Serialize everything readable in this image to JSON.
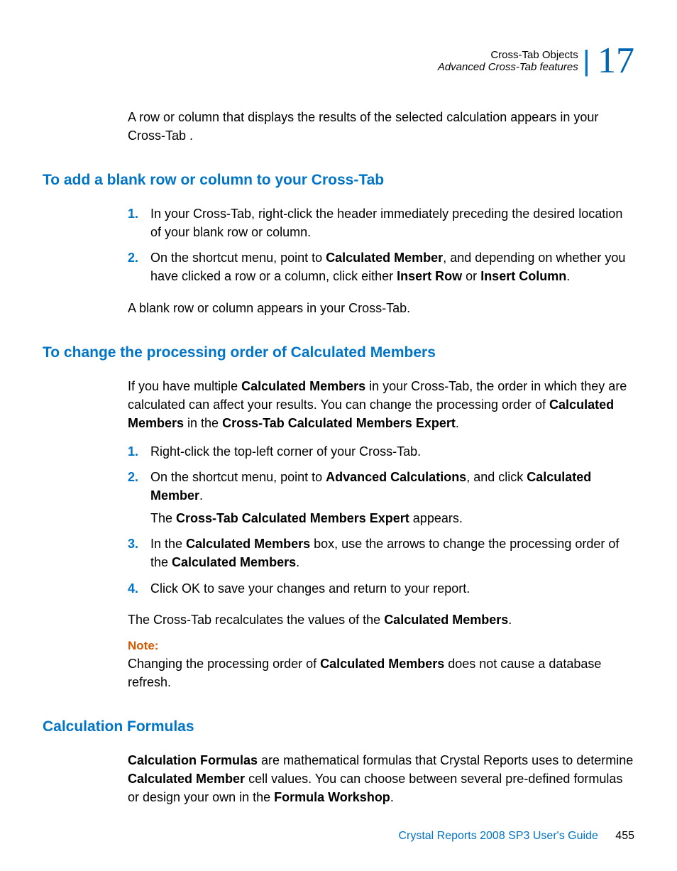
{
  "header": {
    "chapter": "Cross-Tab Objects",
    "subtitle": "Advanced Cross-Tab features",
    "number": "17"
  },
  "intro_p": "A row or column that displays the results of the selected calculation appears in your Cross-Tab .",
  "section1": {
    "title": "To add a blank row or column to your Cross-Tab",
    "step1": "In your Cross-Tab, right-click the header immediately preceding the desired location of your blank row or column.",
    "step2_pre": "On the shortcut menu, point to ",
    "step2_b1": "Calculated Member",
    "step2_mid": ", and depending on whether you have clicked a row or a column, click either ",
    "step2_b2": "Insert Row",
    "step2_or": " or ",
    "step2_b3": "Insert Column",
    "step2_end": ".",
    "result": "A blank row or column appears in your Cross-Tab."
  },
  "section2": {
    "title": "To change the processing order of Calculated Members",
    "intro_pre": "If you have multiple ",
    "intro_b1": "Calculated Members",
    "intro_mid1": " in your Cross-Tab, the order in which they are calculated can affect your results. You can change the processing order of ",
    "intro_b2": "Calculated Members",
    "intro_mid2": " in the ",
    "intro_b3": "Cross-Tab Calculated Members Expert",
    "intro_end": ".",
    "step1": "Right-click the top-left corner of your Cross-Tab.",
    "step2_pre": "On the shortcut menu, point to ",
    "step2_b1": "Advanced Calculations",
    "step2_mid": ", and click ",
    "step2_b2": "Calculated Member",
    "step2_end": ".",
    "step2_sub_pre": "The ",
    "step2_sub_b": "Cross-Tab Calculated Members Expert",
    "step2_sub_end": " appears.",
    "step3_pre": "In the ",
    "step3_b1": "Calculated Members",
    "step3_mid": " box, use the arrows to change the processing order of the ",
    "step3_b2": "Calculated Members",
    "step3_end": ".",
    "step4": "Click OK to save your changes and return to your report.",
    "result_pre": "The Cross-Tab recalculates the values of the ",
    "result_b": "Calculated Members",
    "result_end": ".",
    "note_label": "Note:",
    "note_pre": "Changing the processing order of ",
    "note_b": "Calculated Members",
    "note_end": " does not cause a database refresh."
  },
  "section3": {
    "title": "Calculation Formulas",
    "p_b1": "Calculation Formulas",
    "p_mid1": " are mathematical formulas that Crystal Reports uses to determine ",
    "p_b2": "Calculated Member",
    "p_mid2": " cell values. You can choose between several pre-defined formulas or design your own in the ",
    "p_b3": "Formula Workshop",
    "p_end": "."
  },
  "footer": {
    "guide": "Crystal Reports 2008 SP3 User's Guide",
    "page": "455"
  },
  "nums": {
    "n1": "1.",
    "n2": "2.",
    "n3": "3.",
    "n4": "4."
  }
}
